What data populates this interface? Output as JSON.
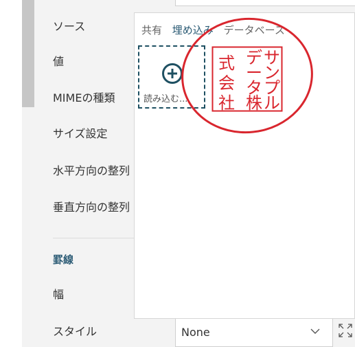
{
  "properties": {
    "source": "ソース",
    "value": "値",
    "mime_type": "MIMEの種類",
    "size_setting": "サイズ設定",
    "horizontal_align": "水平方向の整列",
    "vertical_align": "垂直方向の整列"
  },
  "border_section": {
    "title": "罫線",
    "width_label": "幅",
    "style_label": "スタイル",
    "style_value": "None"
  },
  "popup": {
    "tabs": [
      "共有",
      "埋め込み",
      "データベース"
    ],
    "active_tab": "埋め込み",
    "upload_label": "読み込む...",
    "stamp_text": "サンプルデータ株式会社",
    "stamp_color": "#d9262e"
  },
  "colors": {
    "accent": "#2a5a74",
    "upload_border": "#1e5062",
    "annotation": "#d9262e"
  },
  "icons": {
    "upload": "plus-circle-icon",
    "dropdown": "chevron-down-icon",
    "expand": "expand-icon"
  }
}
